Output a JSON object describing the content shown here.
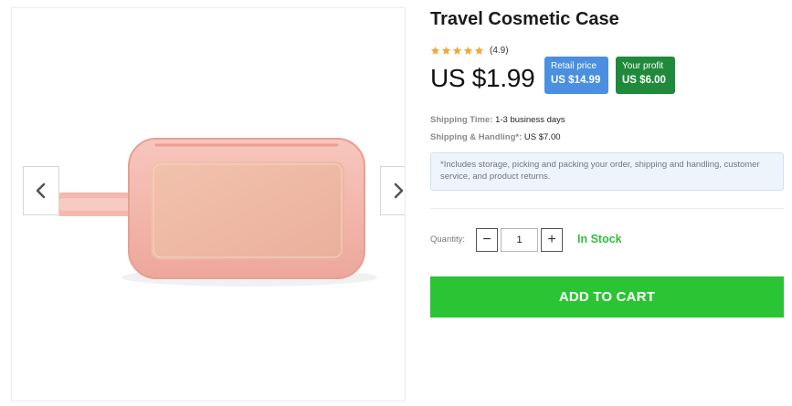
{
  "product": {
    "title": "Travel Cosmetic Case",
    "rating_value": "(4.9)",
    "rating_stars": 5,
    "price": "US $1.99",
    "retail": {
      "label": "Retail price",
      "value": "US $14.99"
    },
    "profit": {
      "label": "Your profit",
      "value": "US $6.00"
    }
  },
  "shipping": {
    "time_label": "Shipping Time:",
    "time_value": " 1-3 business days",
    "handling_label": "Shipping & Handling*:",
    "handling_value": " US $7.00",
    "note": "*Includes storage, picking and packing your order, shipping and handling, customer service, and product returns."
  },
  "quantity": {
    "label": "Quantity:",
    "value": "1",
    "minus_symbol": "−",
    "plus_symbol": "+"
  },
  "stock_status": "In Stock",
  "cart_button": "ADD TO CART",
  "gallery": {
    "prev_icon": "chevron-left-icon",
    "next_icon": "chevron-right-icon"
  },
  "colors": {
    "retail_badge": "#4a8fe0",
    "profit_badge": "#1f8a3b",
    "stock_text": "#2fbf3a",
    "cart_button": "#2bc435",
    "star": "#f3a83a"
  }
}
